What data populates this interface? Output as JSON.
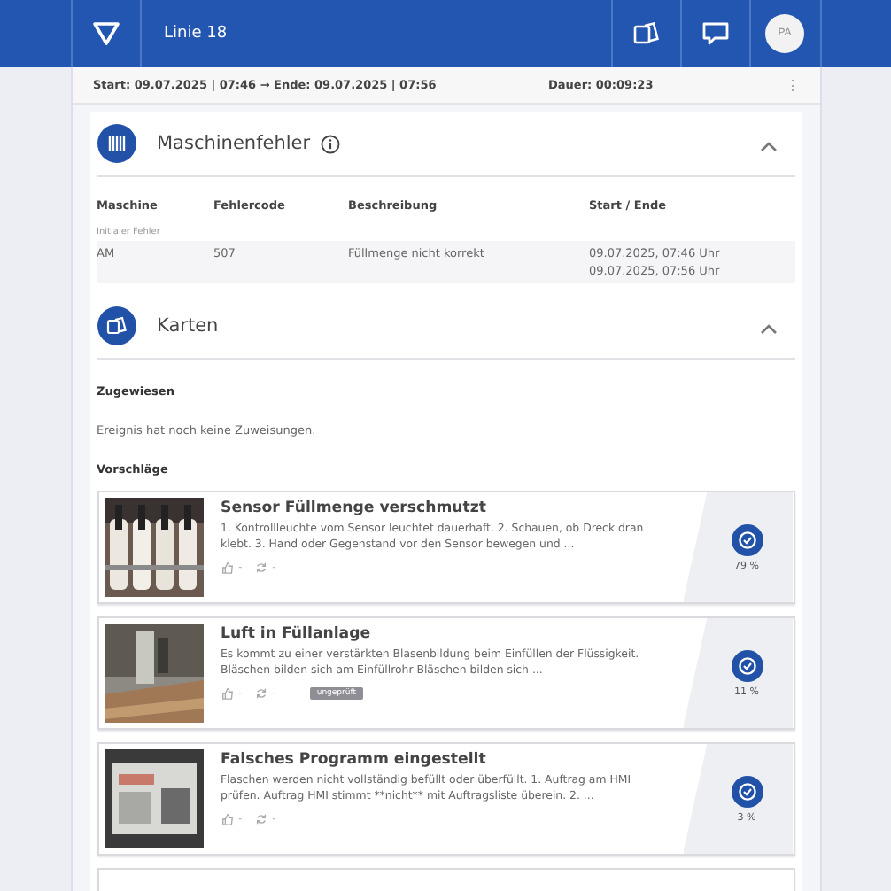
{
  "header": {
    "title": "Linie 18",
    "avatar": "PA"
  },
  "event_bar": {
    "period": "Start: 09.07.2025 | 07:46 → Ende: 09.07.2025 | 07:56",
    "duration": "Dauer: 00:09:23",
    "menu": "⋮"
  },
  "machine_errors": {
    "title": "Maschinenfehler",
    "expanded": true,
    "columns": [
      "Maschine",
      "Fehlercode",
      "Beschreibung",
      "Start / Ende"
    ],
    "group_label": "Initialer Fehler",
    "rows": [
      {
        "machine": "AM",
        "code": "507",
        "description": "Füllmenge nicht korrekt",
        "start": "09.07.2025, 07:46 Uhr",
        "end": "09.07.2025, 07:56 Uhr"
      }
    ]
  },
  "cards": {
    "title": "Karten",
    "expanded": true,
    "assigned_heading": "Zugewiesen",
    "assigned_empty": "Ereignis hat noch keine Zuweisungen.",
    "suggestions_heading": "Vorschläge",
    "suggestions": [
      {
        "title": "Sensor Füllmenge verschmutzt",
        "text": "1. Kontrollleuchte vom Sensor leuchtet dauerhaft.  2. Schauen, ob Dreck dran klebt.  3. Hand oder Gegenstand vor den Sensor bewegen und ...",
        "likes": "-",
        "uses": "-",
        "percent": "79 %"
      },
      {
        "title": "Luft in Füllanlage",
        "text": "Es kommt zu einer verstärkten Blasenbildung beim Einfüllen der Flüssigkeit.  Bläschen bilden sich am Einfüllrohr  Bläschen bilden sich ...",
        "likes": "-",
        "uses": "-",
        "tag": "ungeprüft",
        "percent": "11 %"
      },
      {
        "title": "Falsches Programm eingestellt",
        "text": "Flaschen werden nicht vollständig befüllt oder überfüllt.    1. Auftrag am HMI prüfen. Auftrag HMI stimmt **nicht** mit Auftragsliste überein.  2. ...",
        "likes": "-",
        "uses": "-",
        "percent": "3 %"
      }
    ]
  }
}
